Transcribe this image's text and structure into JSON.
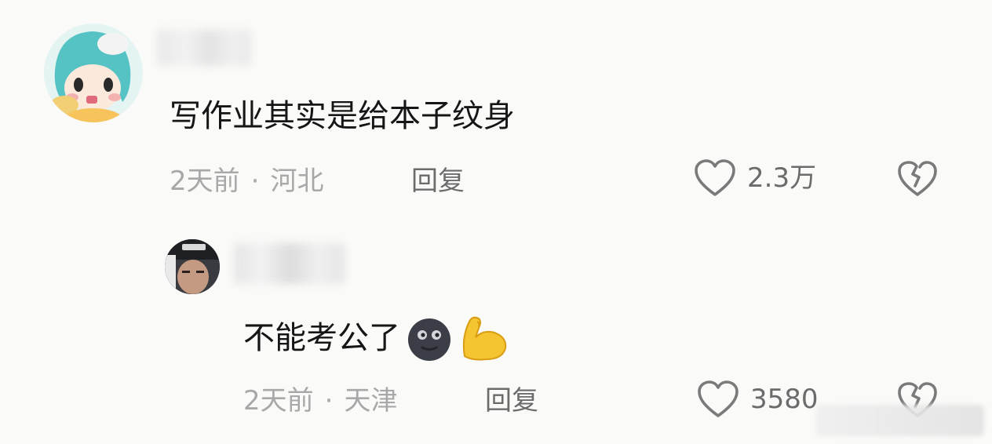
{
  "comments": [
    {
      "text": "写作业其实是给本子纹身",
      "time": "2天前",
      "separator": "·",
      "location": "河北",
      "reply_label": "回复",
      "likes": "2.3万"
    },
    {
      "text": "不能考公了",
      "emojis": [
        "new-moon-face-emoji",
        "flexed-biceps-emoji"
      ],
      "time": "2天前",
      "separator": "·",
      "location": "天津",
      "reply_label": "回复",
      "likes": "3580"
    }
  ],
  "colors": {
    "background": "#fafaf8",
    "text_primary": "#161616",
    "text_secondary": "#a8a8a8",
    "action_text": "#6b6b6b",
    "icon_stroke": "#7a7a7a"
  }
}
